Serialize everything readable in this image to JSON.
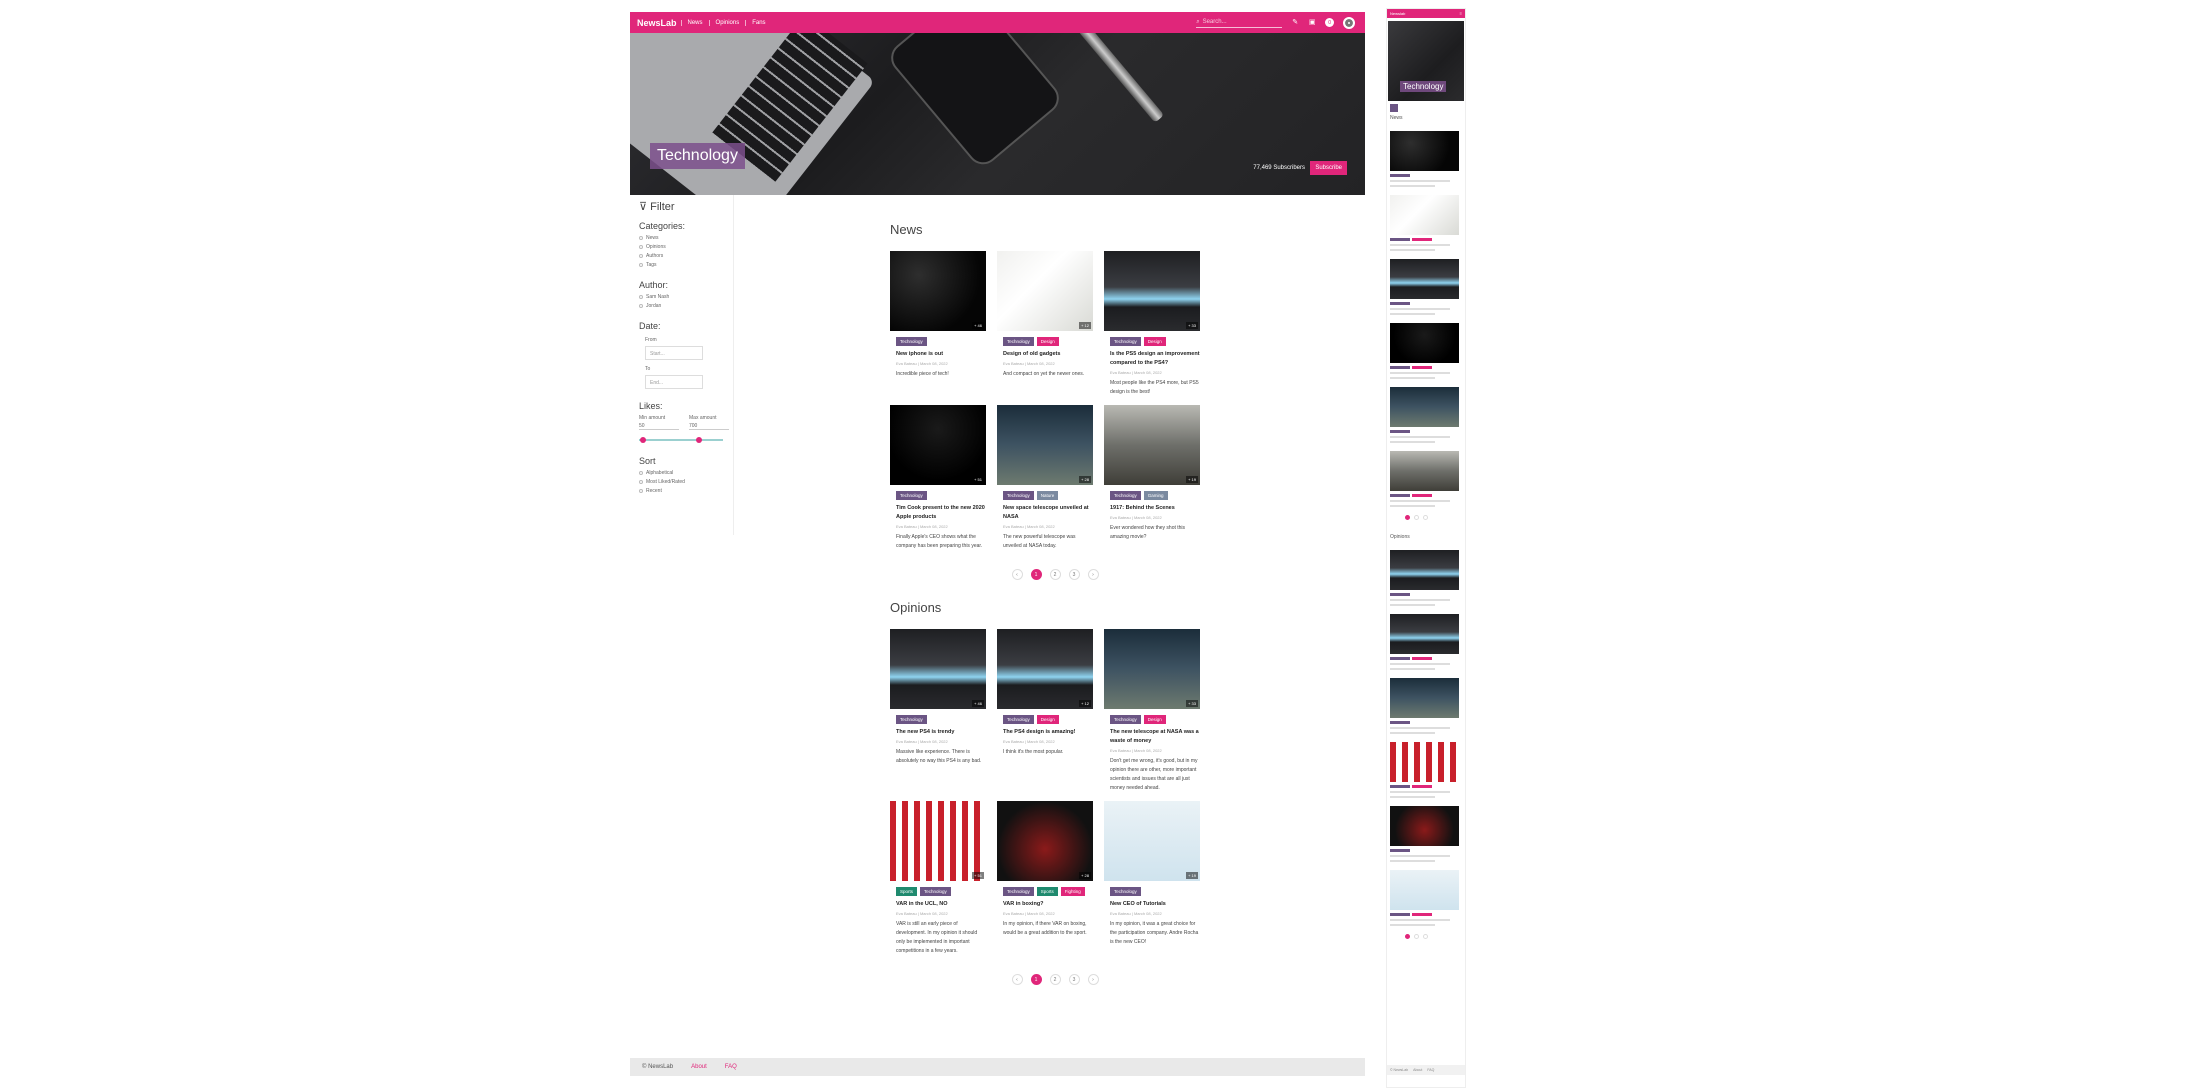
{
  "nav": {
    "brand": "NewsLab",
    "links": [
      "News",
      "Opinions",
      "Fans"
    ],
    "search_placeholder": "Search...",
    "icons": [
      "pencil-icon",
      "bookmark-icon",
      "notification-icon"
    ],
    "counter": "0"
  },
  "hero": {
    "category": "Technology",
    "subscribers": "77,469 Subscribers",
    "subscribe_label": "Subscribe"
  },
  "filter": {
    "title": "Filter",
    "categories_label": "Categories:",
    "categories": [
      "News",
      "Opinions",
      "Authors",
      "Tags"
    ],
    "author_label": "Author:",
    "authors": [
      "Sam Nash",
      "Jordan"
    ],
    "date_label": "Date:",
    "from_label": "From",
    "from_placeholder": "Start...",
    "to_label": "To",
    "to_placeholder": "End...",
    "likes_label": "Likes:",
    "min_label": "Min amount",
    "min_value": "50",
    "max_label": "Max amount",
    "max_value": "700",
    "slider_min_fraction": 0.05,
    "slider_max_fraction": 0.72,
    "sort_label": "Sort",
    "sort_options": [
      "Alphabetical",
      "Most Liked/Rated",
      "Recent"
    ]
  },
  "news": {
    "title": "News",
    "cards": [
      {
        "tags": [
          "Technology"
        ],
        "title": "New iphone is out",
        "meta": "Eva Bateau | March 08, 2022",
        "desc": "Incredible piece of tech!",
        "count": "+ 46",
        "img": "img-phone"
      },
      {
        "tags": [
          "Technology",
          "Design"
        ],
        "title": "Design of old gadgets",
        "meta": "Eva Bateau | March 08, 2022",
        "desc": "And compact on yet the newer ones.",
        "count": "+ 12",
        "img": "img-cable"
      },
      {
        "tags": [
          "Technology",
          "Design"
        ],
        "title": "Is the PS5 design an improvement compared to the PS4?",
        "meta": "Eva Bateau | March 08, 2022",
        "desc": "Most people like the PS4 more, but PS5 design is the best!",
        "count": "+ 33",
        "img": "img-ps5"
      },
      {
        "tags": [
          "Technology"
        ],
        "title": "Tim Cook present to the new 2020 Apple products",
        "meta": "Eva Bateau | March 08, 2022",
        "desc": "Finally Apple's CEO shows what the company has been preparing this year.",
        "count": "+ 51",
        "img": "img-apple"
      },
      {
        "tags": [
          "Technology",
          "Nature"
        ],
        "title": "New space telescope unveiled at NASA",
        "meta": "Eva Bateau | March 08, 2022",
        "desc": "The new powerful telescope was unveiled at NASA today.",
        "count": "+ 28",
        "img": "img-sky"
      },
      {
        "tags": [
          "Technology",
          "Gaming"
        ],
        "title": "1917: Behind the Scenes",
        "meta": "Eva Bateau | March 08, 2022",
        "desc": "Ever wondered how they shot this amazing movie?",
        "count": "+ 19",
        "img": "img-war"
      }
    ],
    "pages": [
      "‹",
      "1",
      "2",
      "3",
      "›"
    ]
  },
  "opinions": {
    "title": "Opinions",
    "cards": [
      {
        "tags": [
          "Technology"
        ],
        "title": "The new PS4 is trendy",
        "meta": "Eva Bateau | March 08, 2022",
        "desc": "Massive like experience. There is absolutely no way this PS4 is any bad.",
        "count": "+ 46",
        "img": "img-ps5"
      },
      {
        "tags": [
          "Technology",
          "Design"
        ],
        "title": "The PS4 design is amazing!",
        "meta": "Eva Bateau | March 08, 2022",
        "desc": "I think it's the most popular.",
        "count": "+ 12",
        "img": "img-ps5"
      },
      {
        "tags": [
          "Technology",
          "Design"
        ],
        "title": "The new telescope at NASA was a waste of money",
        "meta": "Eva Bateau | March 08, 2022",
        "desc": "Don't get me wrong, it's good, but in my opinion there are other, more important scientists and issues that are all just money needed ahead.",
        "count": "+ 33",
        "img": "img-sky"
      },
      {
        "tags": [
          "Sports",
          "Technology"
        ],
        "title": "VAR in the UCL, NO",
        "meta": "Eva Bateau | March 08, 2022",
        "desc": "VAR is still an early piece of development. In my opinion it should only be implemented in important competitions in a few years.",
        "count": "+ 51",
        "img": "img-soccer"
      },
      {
        "tags": [
          "Technology",
          "Sports",
          "Fighting"
        ],
        "title": "VAR in boxing?",
        "meta": "Eva Bateau | March 08, 2022",
        "desc": "In my opinion, if there VAR on boxing, would be a great addition to the sport.",
        "count": "+ 28",
        "img": "img-boxer"
      },
      {
        "tags": [
          "Technology"
        ],
        "title": "New CEO of Tutorials",
        "meta": "Eva Bateau | March 08, 2022",
        "desc": "In my opinion, it was a great choice for the participation company. Andre Rocha is the new CEO!",
        "count": "+ 19",
        "img": "img-ceo"
      }
    ],
    "pages": [
      "‹",
      "1",
      "2",
      "3",
      "›"
    ]
  },
  "footer": {
    "copyright": "© NewsLab",
    "links": [
      "About",
      "FAQ"
    ]
  },
  "side": {
    "head": "Newslab",
    "hero_label": "Technology",
    "news_label": "News",
    "opinions_label": "Opinions",
    "news_imgs": [
      "img-phone",
      "img-cable",
      "img-ps5",
      "img-apple",
      "img-sky",
      "img-war"
    ],
    "opinion_imgs": [
      "img-ps5",
      "img-ps5",
      "img-sky",
      "img-soccer",
      "img-boxer",
      "img-ceo"
    ],
    "footer": [
      "© NewsLab",
      "About",
      "FAQ"
    ]
  }
}
